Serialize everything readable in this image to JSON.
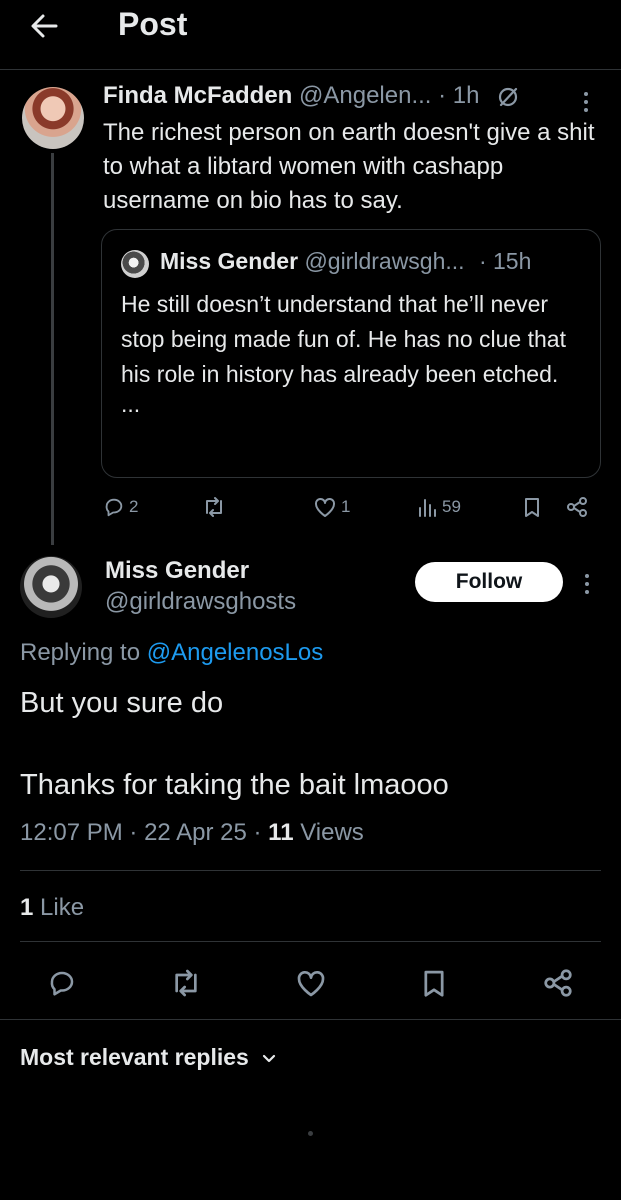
{
  "header": {
    "title": "Post"
  },
  "parent_tweet": {
    "name": "Finda McFadden",
    "handle": "@Angelen...",
    "time": "· 1h",
    "text": "The richest person on earth doesn't give a shit to what a libtard women with cashapp username on bio has to say.",
    "quoted": {
      "name": "Miss Gender",
      "handle": "@girldrawsgh...",
      "time": "· 15h",
      "text": "He still doesn’t understand that he’ll never stop being made fun of. He has no clue that his role in history has already been etched.",
      "ellipsis": "..."
    },
    "actions": {
      "replies": "2",
      "reposts": "",
      "likes": "1",
      "views": "59"
    }
  },
  "main_tweet": {
    "name": "Miss Gender",
    "handle": "@girldrawsghosts",
    "follow_label": "Follow",
    "replying_prefix": "Replying to",
    "replying_handle": "@AngelenosLos",
    "text_line1": "But you sure do",
    "text_line2": "Thanks for taking the bait lmaooo",
    "time": "12:07 PM",
    "date": "22 Apr 25",
    "views_count": "11",
    "views_label": "Views",
    "likes_count": "1",
    "likes_label": "Like"
  },
  "replies_filter": {
    "label": "Most relevant replies"
  },
  "colors": {
    "background": "#000000",
    "text": "#e7e9ea",
    "muted": "#8b98a5",
    "link": "#1d9bf0",
    "border": "#2f3336"
  }
}
